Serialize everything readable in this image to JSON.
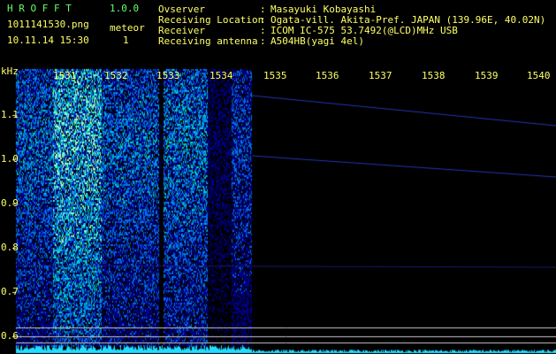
{
  "app": {
    "name": "H R O F F T",
    "version": "1.0.0"
  },
  "file": {
    "name": "1011141530.png",
    "datetime": "10.11.14 15:30"
  },
  "meteor": {
    "label": "meteor",
    "count": "1"
  },
  "info": [
    {
      "key": "Ovserver",
      "sep": ":",
      "value": "Masayuki Kobayashi"
    },
    {
      "key": "Receiving Location",
      "sep": ":",
      "value": "Ogata-vill. Akita-Pref. JAPAN (139.96E, 40.02N)"
    },
    {
      "key": "Receiver",
      "sep": ":",
      "value": "ICOM IC-575 53.7492(@LCD)MHz USB"
    },
    {
      "key": "Receiving antenna",
      "sep": ":",
      "value": "A504HB(yagi 4el)"
    }
  ],
  "axis": {
    "y_unit": "kHz",
    "y_ticks": [
      "1.1",
      "1.0",
      "0.9",
      "0.8",
      "0.7",
      "0.6"
    ],
    "x_ticks": [
      "1531",
      "1532",
      "1533",
      "1534",
      "1535",
      "1536",
      "1537",
      "1538",
      "1539",
      "1540"
    ]
  },
  "colors": {
    "label": "#ffff66",
    "title": "#66ff66",
    "trace": "#22ddff",
    "grid": "#c8c8c8"
  }
}
